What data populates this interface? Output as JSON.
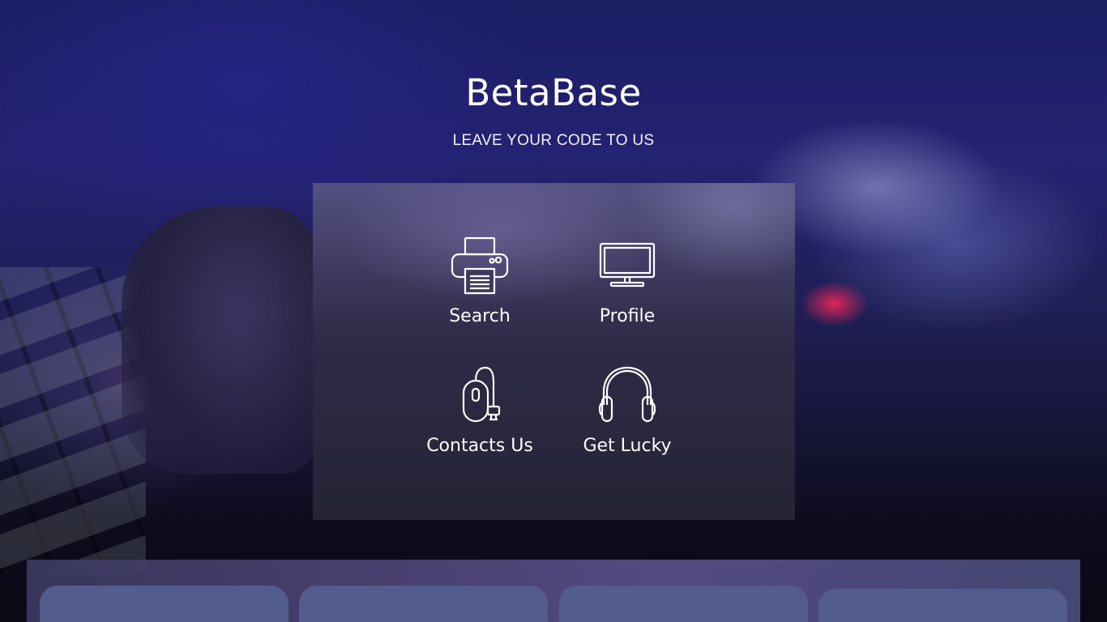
{
  "header": {
    "title": "BetaBase",
    "tagline": "LEAVE YOUR CODE TO US"
  },
  "menu": {
    "items": [
      {
        "label": "Search",
        "icon": "printer-icon"
      },
      {
        "label": "Profile",
        "icon": "monitor-icon"
      },
      {
        "label": "Contacts Us",
        "icon": "mouse-icon"
      },
      {
        "label": "Get Lucky",
        "icon": "headphones-icon"
      }
    ]
  },
  "colors": {
    "card": "#525c8d",
    "text": "#ffffff"
  }
}
